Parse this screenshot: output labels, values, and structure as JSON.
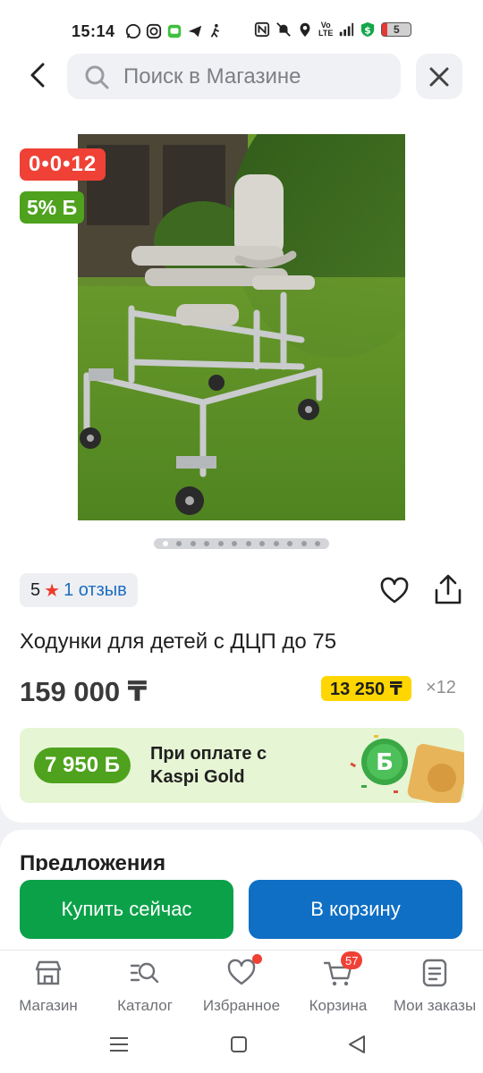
{
  "status": {
    "time": "15:14",
    "network": "4G",
    "volte_top": "Vo",
    "volte_bottom": "LTE",
    "battery": "5"
  },
  "header": {
    "search_placeholder": "Поиск в Магазине"
  },
  "product": {
    "timer": "0•0•12",
    "bonus_percent": "5% Б",
    "rating_value": "5",
    "reviews_link": "1 отзыв",
    "title": "Ходунки для детей с ДЦП до 75",
    "price": "159 000 ₸",
    "installment_price": "13 250 ₸",
    "installment_times": "×12",
    "image_count": 12,
    "active_image": 0
  },
  "gold_banner": {
    "bonus_amount": "7 950 Б",
    "text": "При оплате с Kaspi Gold"
  },
  "offers": {
    "title": "Предложения"
  },
  "actions": {
    "buy_now": "Купить сейчас",
    "add_to_cart": "В корзину"
  },
  "bottom_nav": {
    "items": [
      {
        "label": "Магазин",
        "icon": "shop-icon"
      },
      {
        "label": "Каталог",
        "icon": "catalog-icon"
      },
      {
        "label": "Избранное",
        "icon": "heart-icon"
      },
      {
        "label": "Корзина",
        "icon": "cart-icon",
        "badge": "57"
      },
      {
        "label": "Мои заказы",
        "icon": "orders-icon"
      }
    ]
  },
  "colors": {
    "timer_red": "#ef4136",
    "bonus_green": "#4ea21d",
    "buy_green": "#0ba149",
    "cart_blue": "#0f6fc4",
    "installment_yellow": "#ffd600",
    "link_blue": "#1a6dc2"
  }
}
